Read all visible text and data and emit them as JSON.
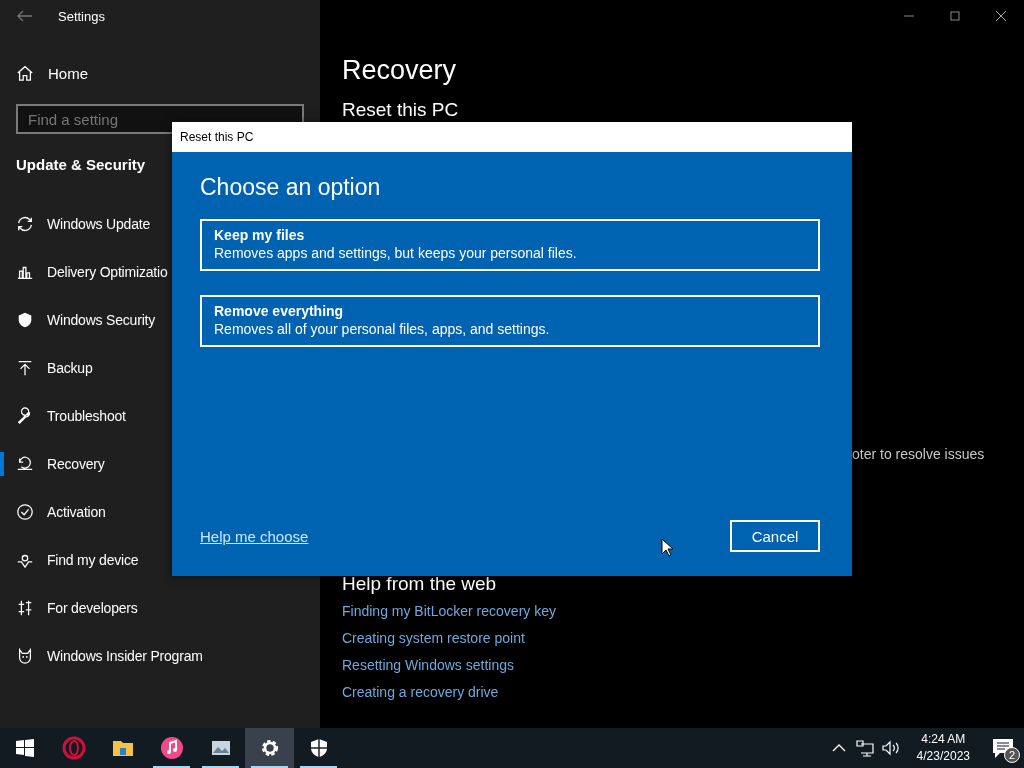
{
  "window": {
    "title": "Settings"
  },
  "sidebar": {
    "home": "Home",
    "search": {
      "placeholder": "Find a setting"
    },
    "section": "Update & Security",
    "items": [
      {
        "label": "Windows Update",
        "selected": false
      },
      {
        "label": "Delivery Optimizatio",
        "selected": false
      },
      {
        "label": "Windows Security",
        "selected": false
      },
      {
        "label": "Backup",
        "selected": false
      },
      {
        "label": "Troubleshoot",
        "selected": false
      },
      {
        "label": "Recovery",
        "selected": true
      },
      {
        "label": "Activation",
        "selected": false
      },
      {
        "label": "Find my device",
        "selected": false
      },
      {
        "label": "For developers",
        "selected": false
      },
      {
        "label": "Windows Insider Program",
        "selected": false
      }
    ]
  },
  "main": {
    "title": "Recovery",
    "heading": "Reset this PC",
    "fragment": "oter to resolve issues",
    "help_heading": "Help from the web",
    "links": [
      "Finding my BitLocker recovery key",
      "Creating system restore point",
      "Resetting Windows settings",
      "Creating a recovery drive"
    ]
  },
  "dialog": {
    "title": "Reset this PC",
    "heading": "Choose an option",
    "options": [
      {
        "title": "Keep my files",
        "description": "Removes apps and settings, but keeps your personal files."
      },
      {
        "title": "Remove everything",
        "description": "Removes all of your personal files, apps, and settings."
      }
    ],
    "help_link": "Help me choose",
    "buttons": [
      "Cancel"
    ]
  },
  "taskbar": {
    "apps": [
      {
        "selected": false,
        "running": false
      },
      {
        "selected": false,
        "running": false
      },
      {
        "selected": false,
        "running": true
      },
      {
        "selected": false,
        "running": true
      },
      {
        "selected": true,
        "running": true
      },
      {
        "selected": false,
        "running": true
      }
    ],
    "time": "4:24 AM",
    "date": "4/23/2023",
    "notifications": "2"
  }
}
